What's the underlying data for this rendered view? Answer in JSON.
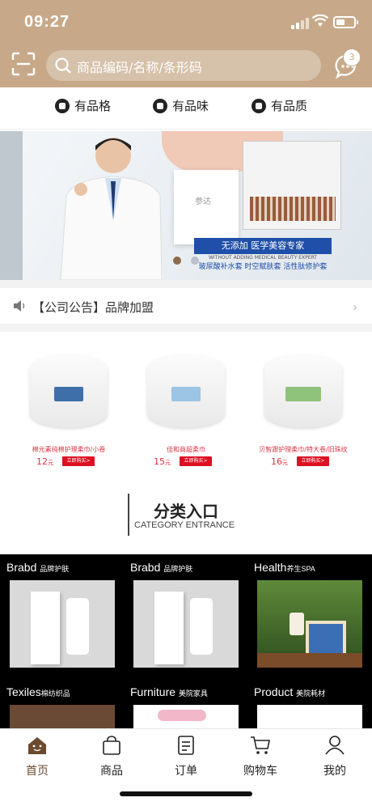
{
  "status_bar": {
    "time": "09:27"
  },
  "header": {
    "search_placeholder": "商品编码/名称/条形码",
    "message_badge": "3",
    "brand_color": "#c7a989"
  },
  "features": [
    "有品格",
    "有品味",
    "有品质"
  ],
  "banner": {
    "headline": "无添加 医学美容专家",
    "tagline": "WITHOUT ADDING MEDICAL BEAUTY EXPERT",
    "products_line": "玻尿酸补水套  时空赋肤套  活性肽修护套",
    "box_label": "参达"
  },
  "notice": {
    "text": "【公司公告】品牌加盟"
  },
  "products": [
    {
      "name": "棉元素纯棉护理柔巾/小卷",
      "price": "12",
      "unit": "元",
      "buy": "立即购买>"
    },
    {
      "name": "佳和商超柔巾",
      "price": "15",
      "unit": "元",
      "buy": "立即购买>"
    },
    {
      "name": "贝智跟护理柔巾/特大卷/旧珠纹",
      "price": "16",
      "unit": "元",
      "buy": "立即购买>"
    }
  ],
  "category": {
    "title": "分类入口",
    "subtitle": "CATEGORY ENTRANCE",
    "items": [
      {
        "en": "Brabd",
        "cn": "品牌护肤"
      },
      {
        "en": "Brabd",
        "cn": "品牌护肤"
      },
      {
        "en": "Health",
        "cn": "养生SPA"
      },
      {
        "en": "Texiles",
        "cn": "棉纺织品"
      },
      {
        "en": "Furniture",
        "cn": "美院家具"
      },
      {
        "en": "Product",
        "cn": "美院耗材"
      }
    ]
  },
  "tabbar": [
    {
      "label": "首页",
      "active": true,
      "icon": "home-icon"
    },
    {
      "label": "商品",
      "active": false,
      "icon": "bag-icon"
    },
    {
      "label": "订单",
      "active": false,
      "icon": "order-icon"
    },
    {
      "label": "购物车",
      "active": false,
      "icon": "cart-icon"
    },
    {
      "label": "我的",
      "active": false,
      "icon": "user-icon"
    }
  ]
}
